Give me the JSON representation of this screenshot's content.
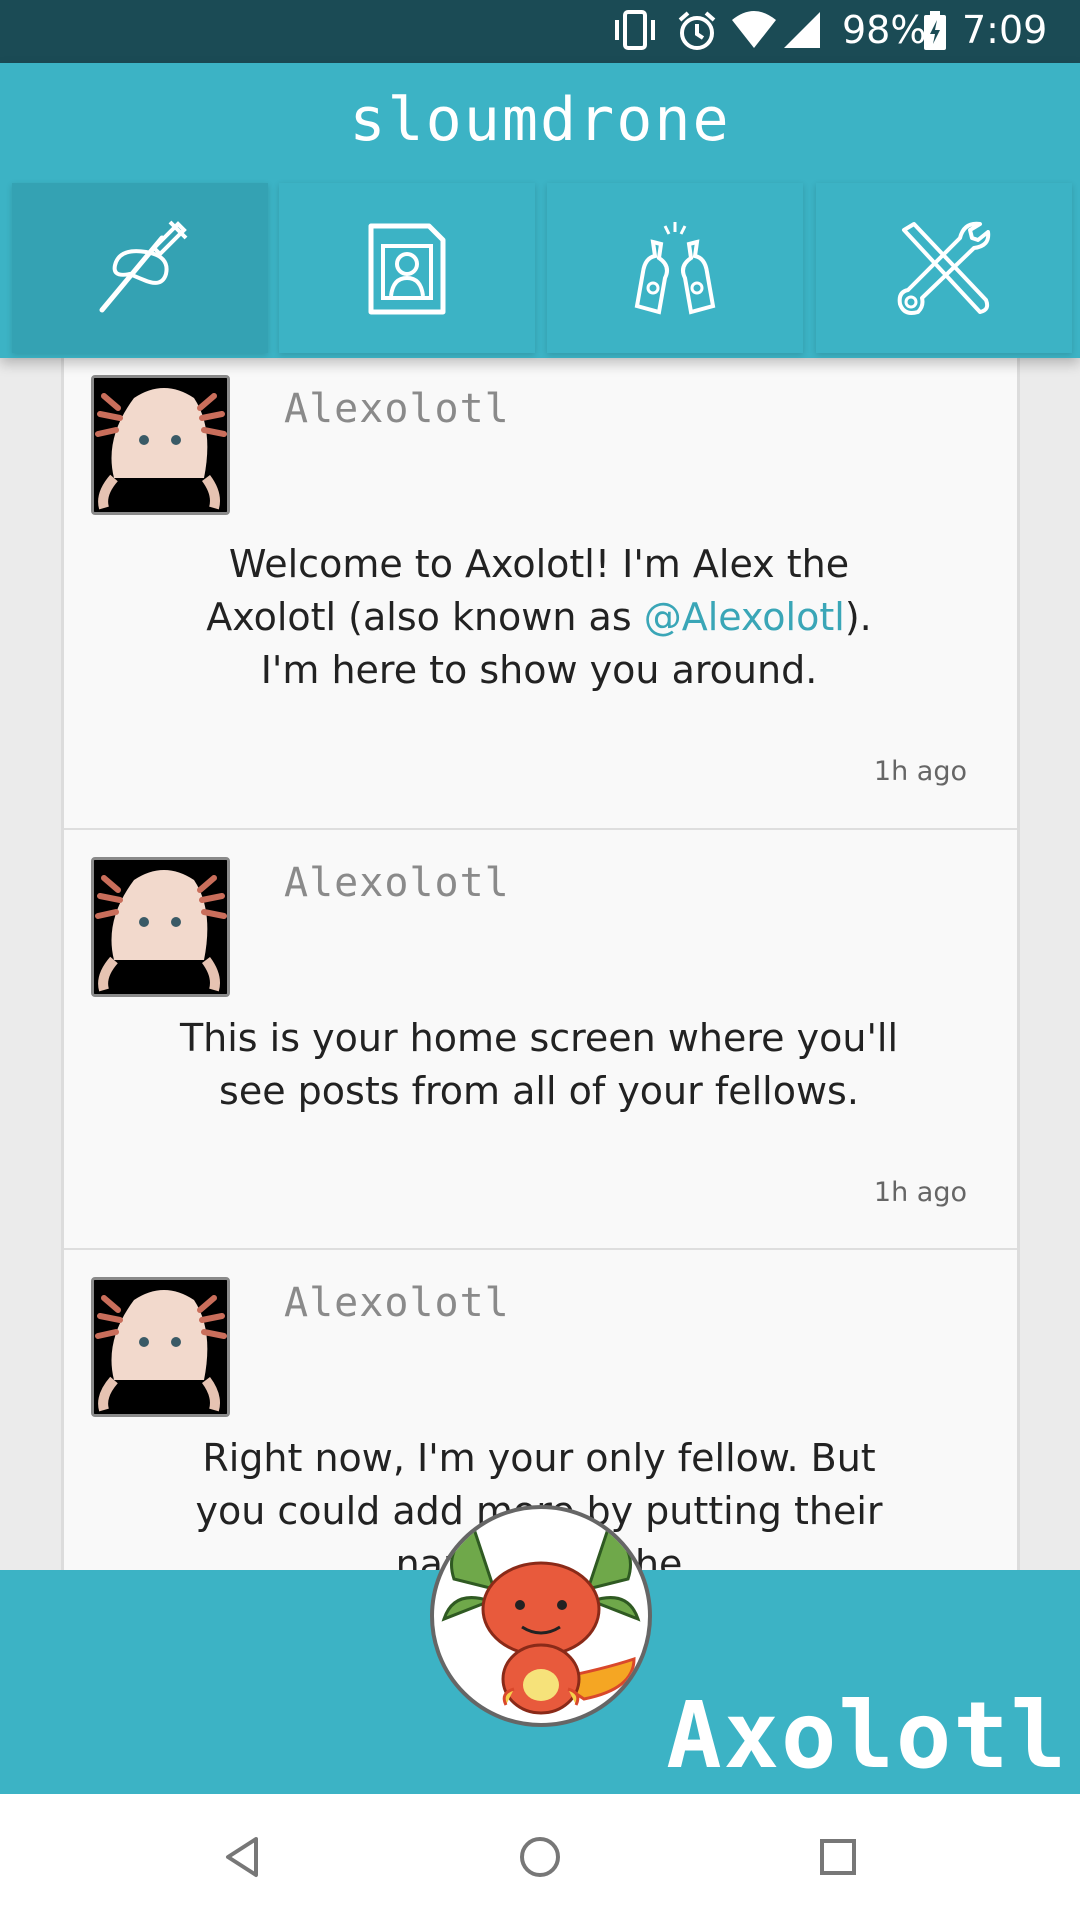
{
  "status_bar": {
    "battery": "98%",
    "time": "7:09",
    "icons": [
      "vibrate-icon",
      "alarm-icon",
      "wifi-icon",
      "signal-icon",
      "battery-charging-icon"
    ]
  },
  "header": {
    "title": "sloumdrone",
    "tabs": [
      {
        "name": "compose",
        "icon": "pen-nib-icon",
        "active": true
      },
      {
        "name": "profile",
        "icon": "profile-card-icon",
        "active": false
      },
      {
        "name": "fellows",
        "icon": "cheers-bottles-icon",
        "active": false
      },
      {
        "name": "settings",
        "icon": "tools-icon",
        "active": false
      }
    ]
  },
  "feed": {
    "posts": [
      {
        "username": "Alexolotl",
        "text_before": "Welcome to Axolotl! I'm Alex the Axolotl (also known as ",
        "mention": "@Alexolotl",
        "text_after": "). I'm here to show you around.",
        "timestamp": "1h ago"
      },
      {
        "username": "Alexolotl",
        "text": "This is your home screen where you'll see posts from all of your fellows.",
        "timestamp": "1h ago"
      },
      {
        "username": "Alexolotl",
        "text": "Right now, I'm your only fellow. But you could add more by putting their names into the",
        "timestamp": ""
      }
    ]
  },
  "brand": {
    "name": "Axolotl",
    "accent_color": "#3cb3c5",
    "status_color": "#1b4b55"
  },
  "nav": {
    "buttons": [
      "back-icon",
      "home-icon",
      "recents-icon"
    ]
  }
}
